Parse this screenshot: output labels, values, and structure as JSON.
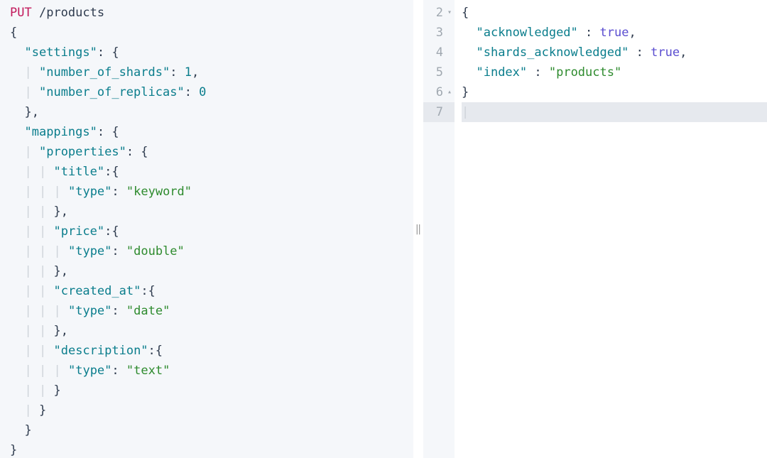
{
  "request": {
    "method": "PUT",
    "path": "/products",
    "body_lines": {
      "l1_open": "{",
      "l2_k": "\"settings\"",
      "l2_after": ": {",
      "l3_k": "\"number_of_shards\"",
      "l3_after": ": ",
      "l3_v": "1",
      "l3_end": ",",
      "l4_k": "\"number_of_replicas\"",
      "l4_after": ": ",
      "l4_v": "0",
      "l5": "},",
      "l6_k": "\"mappings\"",
      "l6_after": ": {",
      "l7_k": "\"properties\"",
      "l7_after": ": {",
      "l8_k": "\"title\"",
      "l8_after": ":{",
      "l9_k": "\"type\"",
      "l9_after": ": ",
      "l9_v": "\"keyword\"",
      "l10": "},",
      "l11_k": "\"price\"",
      "l11_after": ":{",
      "l12_k": "\"type\"",
      "l12_after": ": ",
      "l12_v": "\"double\"",
      "l13": "},",
      "l14_k": "\"created_at\"",
      "l14_after": ":{",
      "l15_k": "\"type\"",
      "l15_after": ": ",
      "l15_v": "\"date\"",
      "l16": "},",
      "l17_k": "\"description\"",
      "l17_after": ":{",
      "l18_k": "\"type\"",
      "l18_after": ": ",
      "l18_v": "\"text\"",
      "l19": "}",
      "l20": "}",
      "l21": "}",
      "l22": "}"
    }
  },
  "response": {
    "gutter": {
      "n2": "2",
      "n3": "3",
      "n4": "4",
      "n5": "5",
      "n6": "6",
      "n7": "7",
      "fold_open": "▾",
      "fold_close": "▴"
    },
    "lines": {
      "l2": "{",
      "l3_k": "\"acknowledged\"",
      "l3_v": "true",
      "l4_k": "\"shards_acknowledged\"",
      "l4_v": "true",
      "l5_k": "\"index\"",
      "l5_v": "\"products\"",
      "l6": "}",
      "l7": ""
    }
  },
  "splitter_glyph": "‖"
}
